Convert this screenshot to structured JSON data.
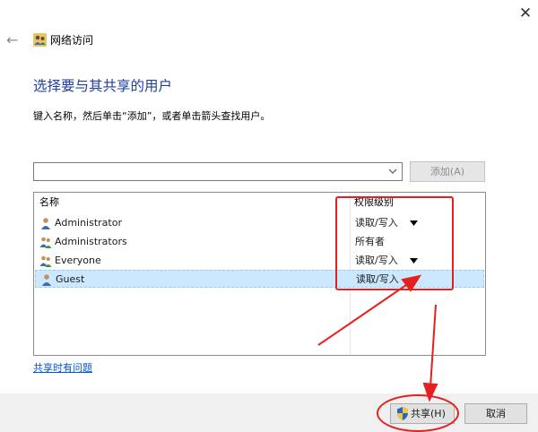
{
  "window": {
    "title": "网络访问",
    "close_glyph": "✕",
    "back_glyph": "←"
  },
  "heading": "选择要与其共享的用户",
  "instruction": "键入名称，然后单击“添加”，或者单击箭头查找用户。",
  "name_input": {
    "value": ""
  },
  "add_button": {
    "label": "添加(A)",
    "enabled": false
  },
  "table": {
    "columns": [
      "名称",
      "权限级别"
    ],
    "rows": [
      {
        "name": "Administrator",
        "permission": "读取/写入",
        "dropdown": true,
        "icon": "user-icon"
      },
      {
        "name": "Administrators",
        "permission": "所有者",
        "dropdown": false,
        "icon": "group-icon"
      },
      {
        "name": "Everyone",
        "permission": "读取/写入",
        "dropdown": true,
        "icon": "group-icon"
      },
      {
        "name": "Guest",
        "permission": "读取/写入",
        "dropdown": true,
        "icon": "user-icon",
        "selected": true
      }
    ]
  },
  "help_link": "共享时有问题",
  "buttons": {
    "share": "共享(H)",
    "cancel": "取消"
  },
  "colors": {
    "heading": "#1e3f9f",
    "link": "#0055cc",
    "annotation": "#e52020",
    "selection": "#cce8ff"
  }
}
